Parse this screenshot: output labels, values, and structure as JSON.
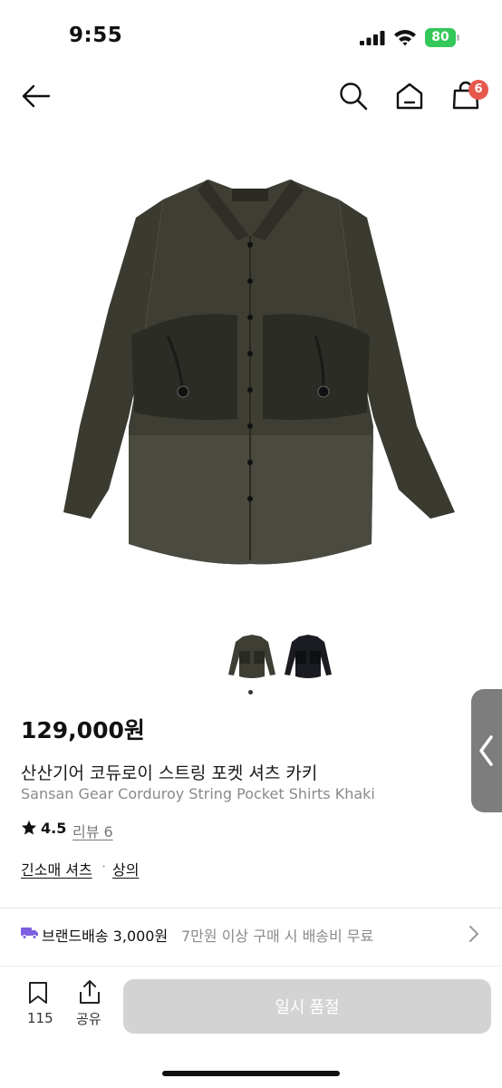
{
  "status_bar": {
    "time": "9:55",
    "battery": "80"
  },
  "nav": {
    "cart_badge": "6",
    "icons": [
      "back-arrow-icon",
      "search-icon",
      "home-icon",
      "shopping-bag-icon"
    ]
  },
  "product": {
    "image": "dark khaki corduroy shirt with string pockets",
    "variants": [
      "khaki",
      "black"
    ],
    "selected_variant_index": 0,
    "price": "129,000원",
    "name_ko": "산산기어 코듀로이 스트링 포켓 셔츠 카키",
    "name_en": "Sansan Gear Corduroy String Pocket Shirts Khaki",
    "rating": "4.5",
    "review_label": "리뷰 6",
    "categories": [
      "긴소매 셔츠",
      "상의"
    ],
    "category_separator": "·"
  },
  "shipping": {
    "label": "브랜드배송 3,000원",
    "note": "7만원 이상 구매 시 배송비 무료"
  },
  "bottom_bar": {
    "like_count": "115",
    "share_label": "공유",
    "buy_label": "일시 품절"
  },
  "colors": {
    "badge": "#e6584b",
    "battery": "#34c759",
    "disabled_button": "#d3d3d3"
  }
}
